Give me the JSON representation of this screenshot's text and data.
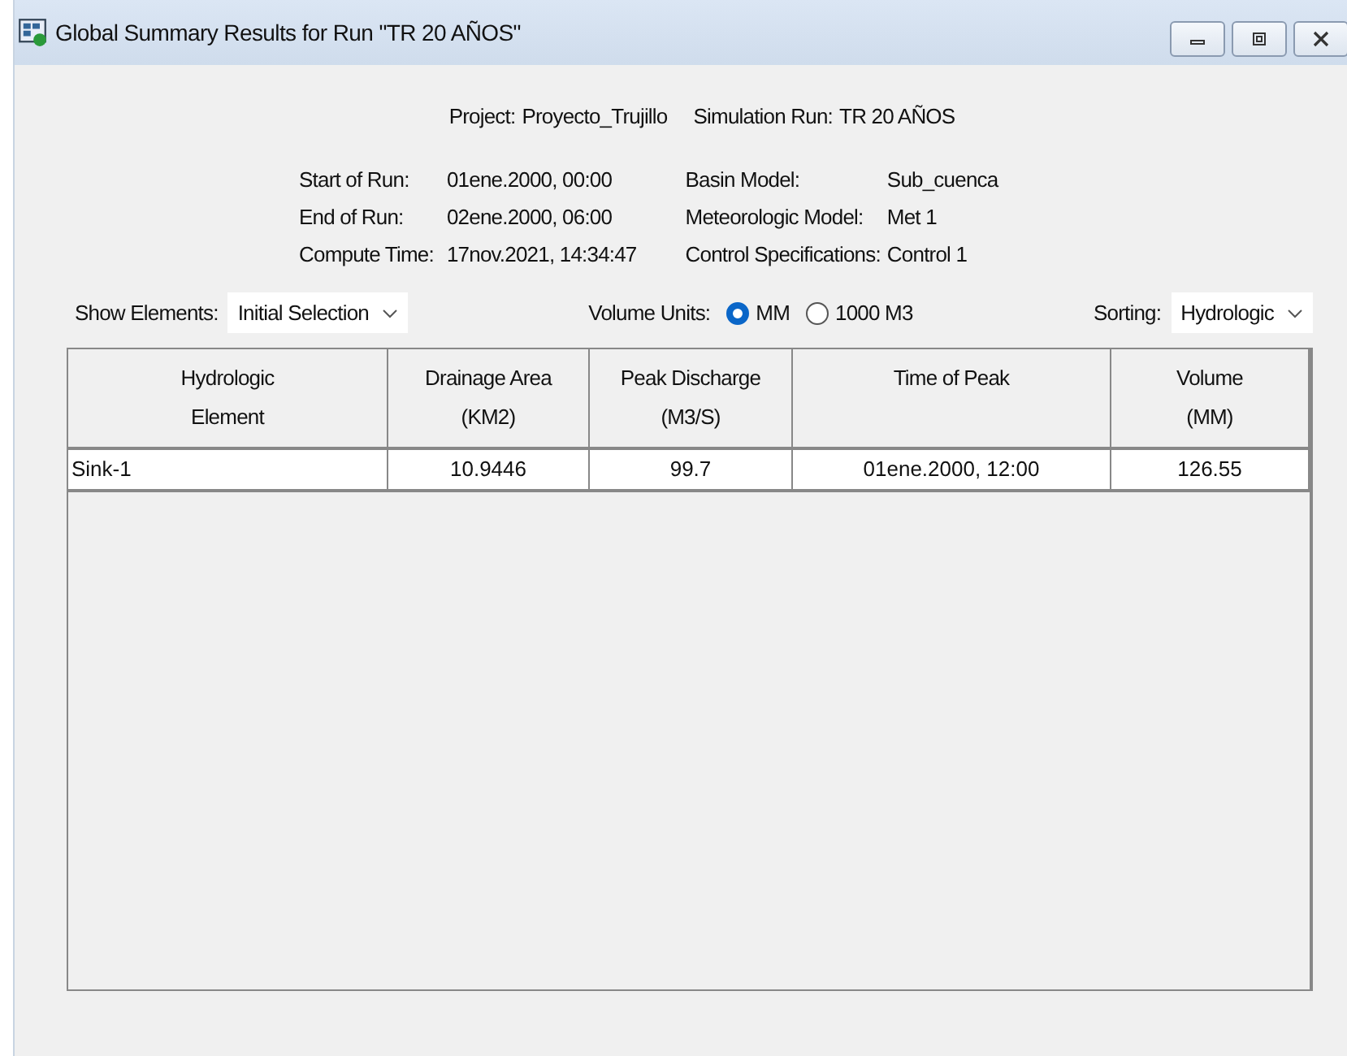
{
  "window": {
    "title": "Global Summary Results for Run \"TR 20 AÑOS\""
  },
  "header": {
    "project_label": "Project:",
    "project": "Proyecto_Trujillo",
    "run_label": "Simulation Run:",
    "run": "TR 20 AÑOS"
  },
  "info_left": [
    {
      "label": "Start of Run:",
      "value": "01ene.2000, 00:00"
    },
    {
      "label": "End of Run:",
      "value": "02ene.2000, 06:00"
    },
    {
      "label": "Compute Time:",
      "value": "17nov.2021, 14:34:47"
    }
  ],
  "info_right": [
    {
      "label": "Basin Model:",
      "value": "Sub_cuenca"
    },
    {
      "label": "Meteorologic Model:",
      "value": "Met 1"
    },
    {
      "label": "Control Specifications:",
      "value": "Control 1"
    }
  ],
  "show_elements": {
    "label": "Show Elements:",
    "value": "Initial Selection"
  },
  "volume_units": {
    "label": "Volume Units:",
    "options": [
      {
        "label": "MM",
        "selected": true
      },
      {
        "label": "1000 M3",
        "selected": false
      }
    ]
  },
  "sorting": {
    "label": "Sorting:",
    "value": "Hydrologic"
  },
  "table": {
    "columns": [
      {
        "lines": [
          "Hydrologic",
          "Element"
        ]
      },
      {
        "lines": [
          "Drainage Area",
          "(KM2)"
        ]
      },
      {
        "lines": [
          "Peak Discharge",
          "(M3/S)"
        ]
      },
      {
        "lines": [
          "Time of Peak"
        ]
      },
      {
        "lines": [
          "Volume",
          "(MM)"
        ]
      }
    ],
    "rows": [
      {
        "cells": [
          "Sink-1",
          "10.9446",
          "99.7",
          "01ene.2000, 12:00",
          "126.55"
        ]
      }
    ]
  }
}
